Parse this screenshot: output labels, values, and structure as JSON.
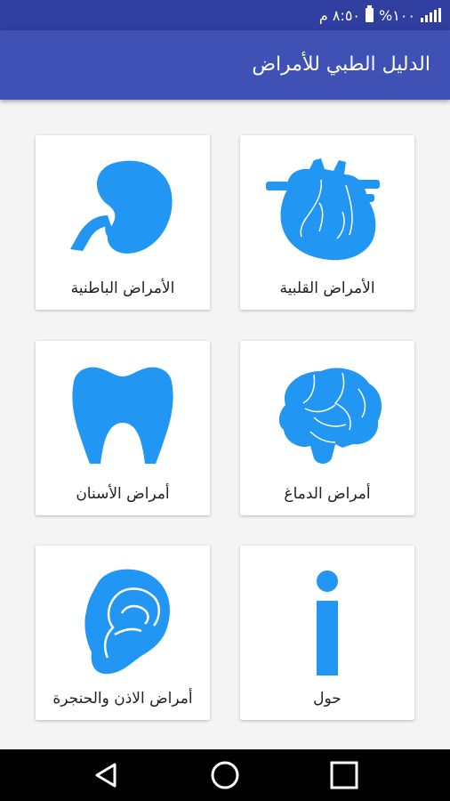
{
  "status_bar": {
    "time": "٨:٥٠ م",
    "battery": "%١٠٠"
  },
  "app_bar": {
    "title": "الدليل الطبي للأمراض"
  },
  "cards": [
    {
      "label": "الأمراض القلبية",
      "icon": "heart-icon"
    },
    {
      "label": "الأمراض الباطنية",
      "icon": "kidney-icon"
    },
    {
      "label": "أمراض الدماغ",
      "icon": "brain-icon"
    },
    {
      "label": "أمراض الأسنان",
      "icon": "tooth-icon"
    },
    {
      "label": "حول",
      "icon": "info-icon"
    },
    {
      "label": "أمراض الاذن والحنجرة",
      "icon": "ear-icon"
    }
  ],
  "navigation": {
    "back": "back-icon",
    "home": "home-icon",
    "recents": "recents-icon"
  },
  "colors": {
    "primary": "#3f51b5",
    "primary_dark": "#303f9f",
    "icon_blue": "#2196f3"
  }
}
